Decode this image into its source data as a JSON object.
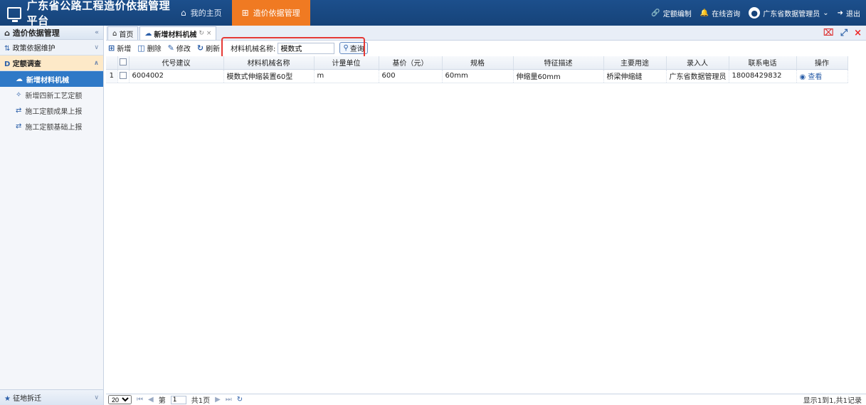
{
  "app": {
    "title": "广东省公路工程造价依据管理平台"
  },
  "nav": [
    {
      "label": "我的主页",
      "icon": "home-icon"
    },
    {
      "label": "造价依据管理",
      "icon": "grid-icon"
    }
  ],
  "top_right": {
    "quota_edit": "定额编制",
    "consult": "在线咨询",
    "user": "广东省数据管理员",
    "logout": "退出"
  },
  "sidebar": {
    "header": "造价依据管理",
    "groups": [
      {
        "label": "政策依据维护",
        "open": false
      },
      {
        "label": "定额调查",
        "open": true
      }
    ],
    "items": [
      {
        "label": "新增材料机械",
        "active": true
      },
      {
        "label": "新增四新工艺定额"
      },
      {
        "label": "施工定额成果上报"
      },
      {
        "label": "施工定额基础上报"
      }
    ],
    "footer": "征地拆迁"
  },
  "tabs": [
    {
      "label": "首页"
    },
    {
      "label": "新增材料机械"
    }
  ],
  "toolbar": {
    "add": "新增",
    "delete": "删除",
    "edit": "修改",
    "refresh": "刷新",
    "search_label": "材料机械名称:",
    "search_value": "模数式",
    "query": "查询"
  },
  "table": {
    "columns": [
      "代号建议",
      "材料机械名称",
      "计量单位",
      "基价（元）",
      "规格",
      "特征描述",
      "主要用途",
      "录入人",
      "联系电话",
      "操作"
    ],
    "rows": [
      {
        "no": "1",
        "code": "6004002",
        "name": "模数式伸缩装置60型",
        "unit": "m",
        "price": "600",
        "spec": "60mm",
        "desc": "伸缩量60mm",
        "use": "桥梁伸缩缝",
        "entry": "广东省数据管理员",
        "phone": "18008429832",
        "action": "查看"
      }
    ]
  },
  "pager": {
    "page_size": "20",
    "page_prefix": "第",
    "page": "1",
    "total_pages": "共1页",
    "info": "显示1到1,共1记录"
  }
}
